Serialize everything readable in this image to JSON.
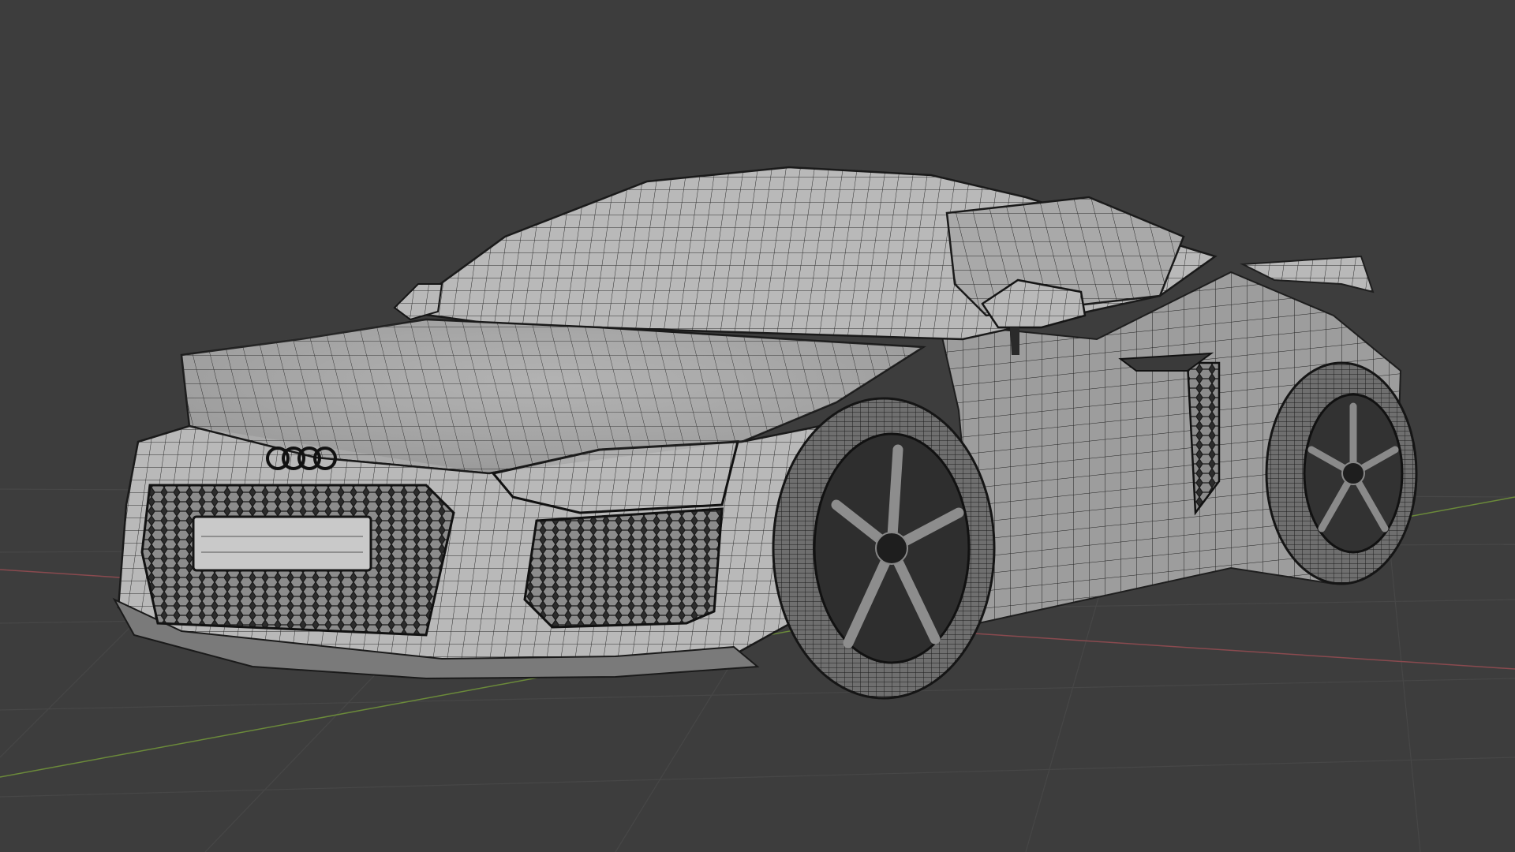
{
  "viewport": {
    "name": "3D Viewport",
    "background_color": "#3d3d3d",
    "grid_color": "#4a4a4a",
    "x_axis_color": "#8a4a4f",
    "y_axis_color": "#6b8a3a"
  },
  "model": {
    "logo_icon": "four-rings-icon",
    "mesh_fill_color": "#b5b5b5",
    "mesh_line_color": "#1f1f1f",
    "dark_detail_color": "#2a2a2a"
  }
}
